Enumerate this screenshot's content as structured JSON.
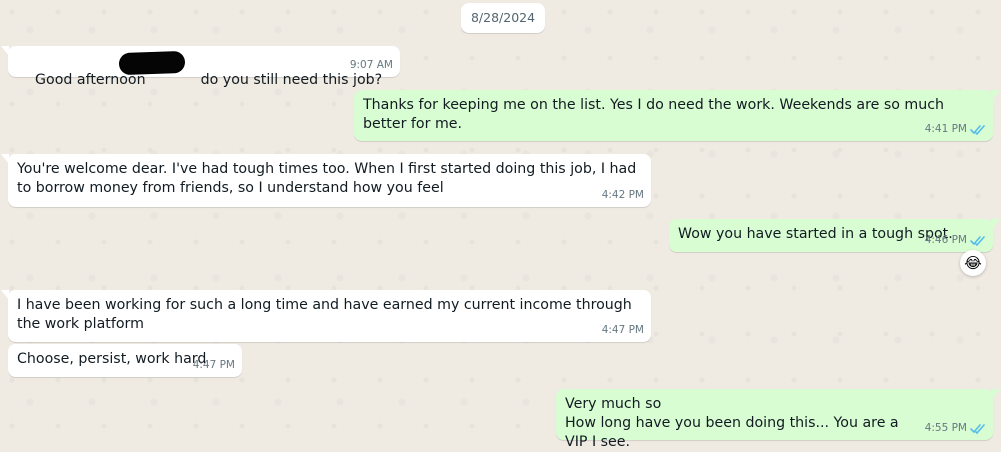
{
  "date_chip": "8/28/2024",
  "messages": [
    {
      "direction": "incoming",
      "text_before": "Good afternoon ",
      "text_after": " do you still need this job?",
      "time": "9:07 AM"
    },
    {
      "direction": "outgoing",
      "text": "Thanks for keeping me on the list. Yes I do need the work. Weekends are so much better for me.",
      "time": "4:41 PM",
      "status": "read"
    },
    {
      "direction": "incoming",
      "text": "You're welcome dear. I've had tough times too. When I first started doing this job, I had to borrow money from friends, so I understand how you feel",
      "time": "4:42 PM"
    },
    {
      "direction": "outgoing",
      "text": "Wow you have started in a tough spot.",
      "time": "4:46 PM",
      "status": "read",
      "reaction": "😂"
    },
    {
      "direction": "incoming",
      "text": "I have been working for such a long time and have earned my current income through the work platform",
      "time": "4:47 PM"
    },
    {
      "direction": "incoming",
      "text": "Choose, persist, work hard",
      "time": "4:47 PM"
    },
    {
      "direction": "outgoing",
      "text": "Very much so\nHow long have you been doing this... You are a VIP I see.",
      "time": "4:55 PM",
      "status": "read"
    }
  ],
  "icons": {
    "read_receipt": "double-check-icon",
    "reaction": "tears-of-joy-emoji"
  },
  "colors": {
    "chat_background": "#efeae2",
    "incoming_bubble": "#ffffff",
    "outgoing_bubble": "#d9fdd3",
    "read_check": "#53bdeb",
    "timestamp": "#667781"
  }
}
